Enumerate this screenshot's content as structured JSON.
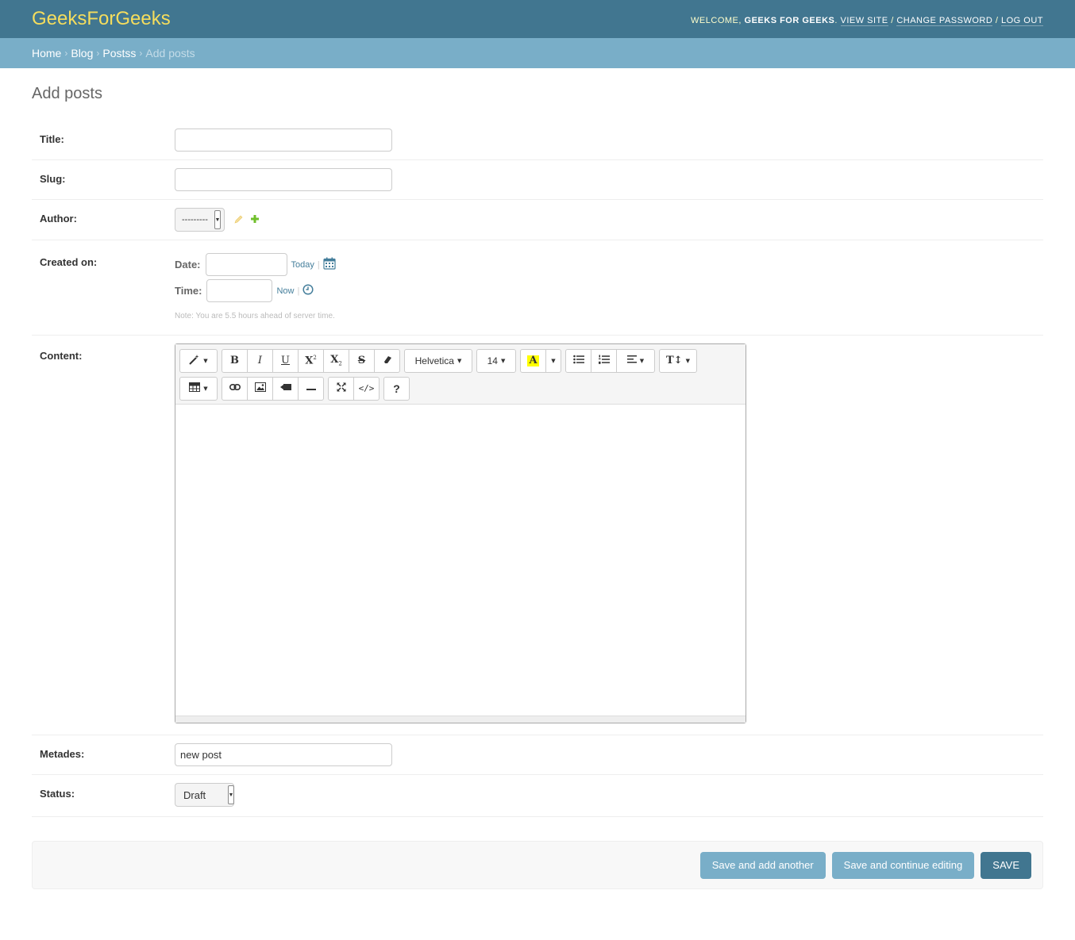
{
  "header": {
    "brand": "GeeksForGeeks",
    "welcome": "Welcome,",
    "user": "Geeks for Geeks",
    "view_site": "View site",
    "change_password": "Change password",
    "log_out": "Log out",
    "sep": "/"
  },
  "breadcrumbs": {
    "home": "Home",
    "app": "Blog",
    "model": "Postss",
    "current": "Add posts",
    "sep": "›"
  },
  "page": {
    "title": "Add posts"
  },
  "form": {
    "title_label": "Title:",
    "title_value": "",
    "slug_label": "Slug:",
    "slug_value": "",
    "author_label": "Author:",
    "author_value": "---------",
    "created_label": "Created on:",
    "date_label": "Date:",
    "today_link": "Today",
    "time_label": "Time:",
    "now_link": "Now",
    "tz_note": "Note: You are 5.5 hours ahead of server time.",
    "content_label": "Content:",
    "metades_label": "Metades:",
    "metades_value": "new post",
    "status_label": "Status:",
    "status_value": "Draft"
  },
  "editor": {
    "font_name": "Helvetica",
    "font_size": "14",
    "bold": "B",
    "italic": "I",
    "underline": "U",
    "help": "?",
    "highlight_color": "#ffff00"
  },
  "buttons": {
    "save_add_another": "Save and add another",
    "save_continue": "Save and continue editing",
    "save": "Save"
  }
}
